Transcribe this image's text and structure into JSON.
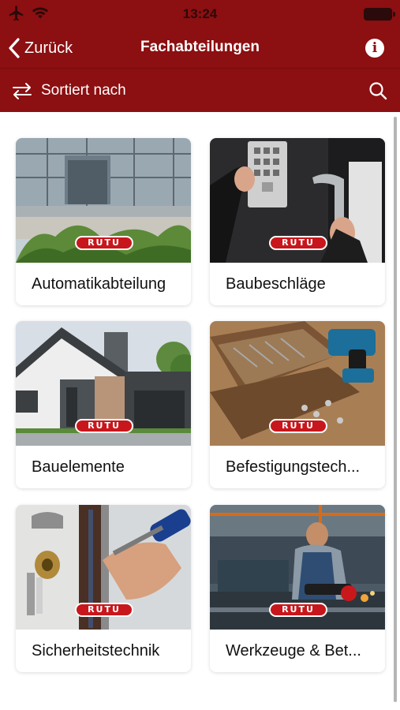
{
  "status_bar": {
    "time": "13:24",
    "icons": [
      "airplane-icon",
      "wifi-icon",
      "battery-icon"
    ]
  },
  "nav": {
    "back_label": "Zurück",
    "title": "Fachabteilungen",
    "info_icon": "info-icon",
    "info_glyph": "i"
  },
  "sort_bar": {
    "sort_label": "Sortiert nach",
    "sort_icon": "swap-arrows-icon",
    "search_icon": "search-icon"
  },
  "brand": {
    "logo_text": "RUTU",
    "primary_color": "#8c0f11",
    "logo_color": "#c8171c"
  },
  "departments": [
    {
      "label": "Automatikabteilung"
    },
    {
      "label": "Baubeschläge"
    },
    {
      "label": "Bauelemente"
    },
    {
      "label": "Befestigungstech..."
    },
    {
      "label": "Sicherheitstechnik"
    },
    {
      "label": "Werkzeuge & Bet..."
    }
  ]
}
